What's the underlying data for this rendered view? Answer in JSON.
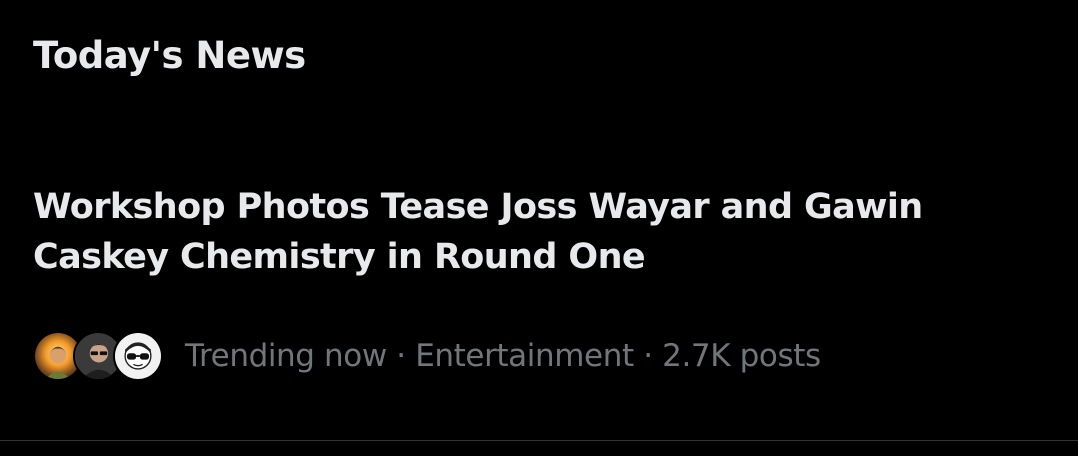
{
  "section": {
    "title": "Today's News"
  },
  "story": {
    "headline": "Workshop Photos Tease Joss Wayar and Gawin Caskey Chemistry in Round One",
    "status": "Trending now",
    "separator": "·",
    "category": "Entertainment",
    "posts": "2.7K posts"
  },
  "avatars": [
    "avatar-fire-portrait",
    "avatar-person-portrait",
    "avatar-sunglasses-cartoon"
  ],
  "colors": {
    "background": "#000000",
    "primary_text": "#e7e9ea",
    "secondary_text": "#71767b",
    "divider": "#2f3336"
  }
}
